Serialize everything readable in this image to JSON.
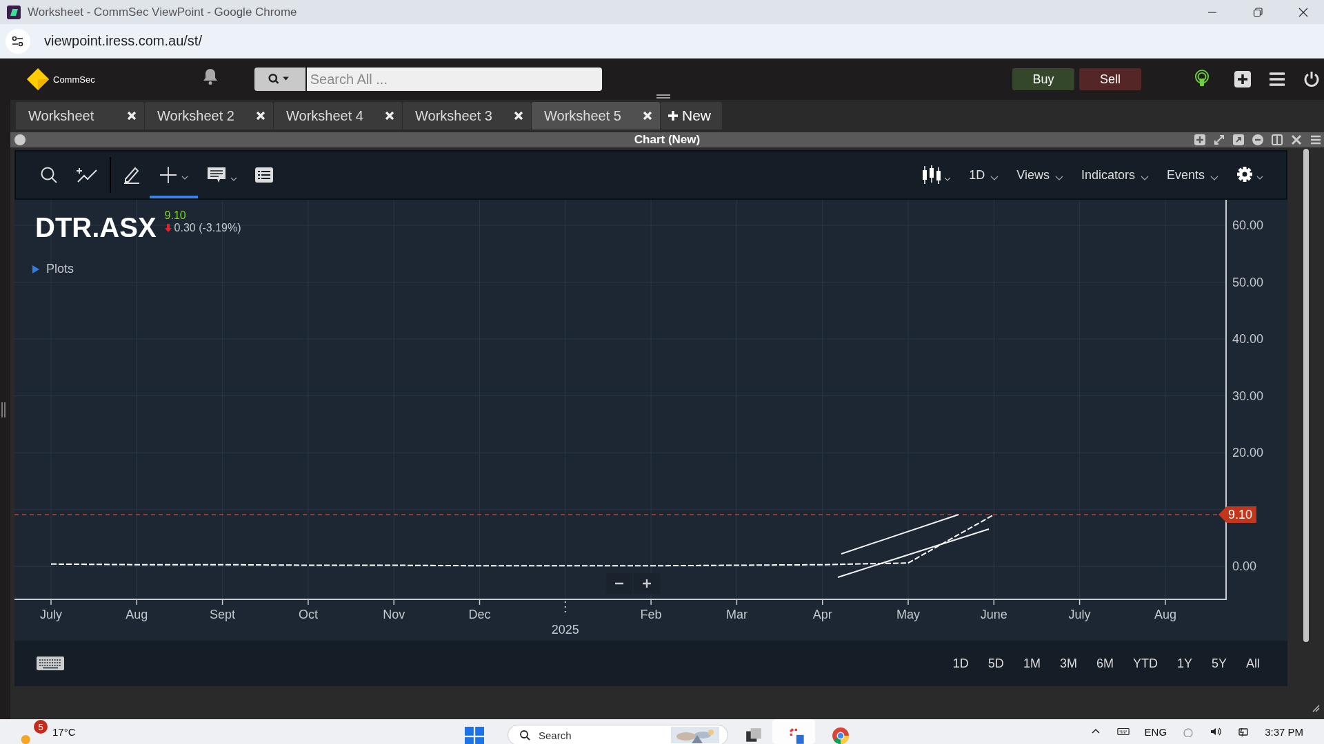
{
  "browser": {
    "title": "Worksheet - CommSec ViewPoint - Google Chrome",
    "url": "viewpoint.iress.com.au/st/"
  },
  "header": {
    "brand": "CommSec",
    "search": {
      "placeholder": "Search All ..."
    },
    "buttons": [
      {
        "label": "Buy",
        "kind": "buy"
      },
      {
        "label": "Sell",
        "kind": "sell"
      }
    ]
  },
  "tabs": [
    {
      "label": "Worksheet",
      "selected": false
    },
    {
      "label": "Worksheet 2",
      "selected": false
    },
    {
      "label": "Worksheet 4",
      "selected": false
    },
    {
      "label": "Worksheet 3",
      "selected": false
    },
    {
      "label": "Worksheet 5",
      "selected": true
    }
  ],
  "new_tab": "New",
  "panel": {
    "title": "Chart (New)"
  },
  "toolbar": {
    "tools": [
      {
        "kind": "search",
        "selected": false
      },
      {
        "kind": "study",
        "selected": false
      },
      {
        "kind": "pencil",
        "selected": false
      },
      {
        "kind": "crosshair",
        "selected": true
      },
      {
        "kind": "comment",
        "selected": false
      },
      {
        "kind": "list",
        "selected": false
      }
    ],
    "menus": [
      "1D",
      "Views",
      "Indicators",
      "Events"
    ]
  },
  "quote": {
    "symbol": "DTR.ASX",
    "price": "9.10",
    "change": "0.30 (-3.19%)"
  },
  "plots_label": "Plots",
  "chart_data": {
    "type": "line",
    "grid": true,
    "series": [
      {
        "color": "#ffffff",
        "line_style": "dashed",
        "values": [
          0.4,
          0.3,
          0.3,
          0.2,
          0.2,
          0.1,
          0.1,
          0.1,
          0.2,
          0.3,
          0.6,
          9.1,
          null,
          null
        ]
      }
    ],
    "categories": [
      "July",
      "Aug",
      "Sept",
      "Oct",
      "Nov",
      "Dec",
      null,
      "Feb",
      "Mar",
      "Apr",
      "May",
      "June",
      "July",
      "Aug"
    ],
    "yticks": [
      {
        "value": 0,
        "label": "0.00"
      },
      {
        "value": 20,
        "label": "20.00"
      },
      {
        "value": 30,
        "label": "30.00"
      },
      {
        "value": 40,
        "label": "40.00"
      },
      {
        "value": 50,
        "label": "50.00"
      },
      {
        "value": 60,
        "label": "60.00"
      }
    ],
    "ylim": [
      -5.8,
      64.5
    ],
    "ref_lines": [
      {
        "axis": "y",
        "value": 9.1,
        "label": "9.10"
      }
    ]
  },
  "year_label": "2025",
  "ranges": [
    "1D",
    "5D",
    "1M",
    "3M",
    "6M",
    "YTD",
    "1Y",
    "5Y",
    "All"
  ],
  "taskbar": {
    "weather": "17°C",
    "badge": "5",
    "search": "Search",
    "language": "ENG",
    "time": "3:37 PM"
  }
}
